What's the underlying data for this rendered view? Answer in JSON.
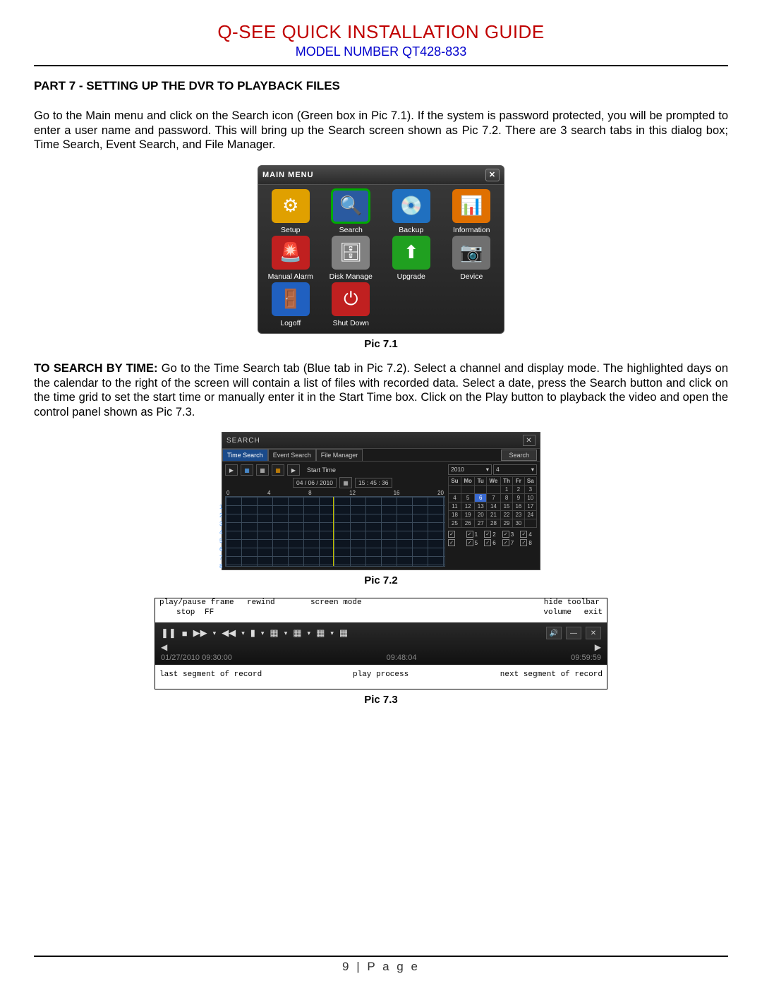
{
  "header": {
    "title": "Q-SEE QUICK INSTALLATION GUIDE",
    "model": "MODEL NUMBER QT428-833"
  },
  "section_heading": "PART 7 - SETTING UP THE DVR TO PLAYBACK FILES",
  "para1": "Go to the Main menu and click on the Search icon (Green box in Pic 7.1). If the system is password protected, you will be prompted to enter a user name and password. This will bring up the Search screen shown as Pic 7.2. There are 3 search tabs in this dialog box; Time Search, Event Search, and File Manager.",
  "para2_lead": "TO SEARCH BY TIME:",
  "para2": " Go to the Time Search tab (Blue tab in Pic 7.2). Select a channel and display mode. The highlighted days on the calendar to the right of the screen will contain a list of files with recorded data. Select a date, press the Search button and click on the time grid to set the start time or manually enter it in the Start Time box. Click on the Play button to playback the video and open the control panel shown as Pic 7.3.",
  "captions": {
    "c1": "Pic 7.1",
    "c2": "Pic 7.2",
    "c3": "Pic 7.3"
  },
  "mainmenu": {
    "title": "MAIN  MENU",
    "close": "✕",
    "items": [
      {
        "label": "Setup",
        "icon": "⚙",
        "bg": "#e0a000"
      },
      {
        "label": "Search",
        "icon": "🔍",
        "bg": "#2a5aa0",
        "highlight": true
      },
      {
        "label": "Backup",
        "icon": "💿",
        "bg": "#2070c0"
      },
      {
        "label": "Information",
        "icon": "📊",
        "bg": "#e07000"
      },
      {
        "label": "Manual Alarm",
        "icon": "🚨",
        "bg": "#c02020"
      },
      {
        "label": "Disk Manage",
        "icon": "🗄",
        "bg": "#808080"
      },
      {
        "label": "Upgrade",
        "icon": "⬆",
        "bg": "#20a020"
      },
      {
        "label": "Device",
        "icon": "📷",
        "bg": "#707070"
      },
      {
        "label": "Logoff",
        "icon": "🚪",
        "bg": "#2060c0"
      },
      {
        "label": "Shut Down",
        "icon": "⏻",
        "bg": "#c02020"
      }
    ]
  },
  "search": {
    "title": "SEARCH",
    "close": "✕",
    "tabs": [
      "Time Search",
      "Event Search",
      "File Manager"
    ],
    "search_btn": "Search",
    "start_time_label": "Start Time",
    "start_date": "04 / 06 / 2010",
    "start_time": "15 : 45 : 36",
    "hours": [
      "0",
      "4",
      "8",
      "12",
      "16",
      "20"
    ],
    "rows": [
      "1",
      "2",
      "3",
      "4",
      "5",
      "6",
      "7",
      "8"
    ],
    "year": "2010",
    "month": "4",
    "dow": [
      "Su",
      "Mo",
      "Tu",
      "We",
      "Th",
      "Fr",
      "Sa"
    ],
    "cal": [
      [
        "",
        "",
        "",
        "",
        "1",
        "2",
        "3"
      ],
      [
        "4",
        "5",
        "6",
        "7",
        "8",
        "9",
        "10"
      ],
      [
        "11",
        "12",
        "13",
        "14",
        "15",
        "16",
        "17"
      ],
      [
        "18",
        "19",
        "20",
        "21",
        "22",
        "23",
        "24"
      ],
      [
        "25",
        "26",
        "27",
        "28",
        "29",
        "30",
        ""
      ]
    ],
    "cal_selected": "6",
    "channels_row1": [
      "1",
      "2",
      "3",
      "4"
    ],
    "channels_row2": [
      "5",
      "6",
      "7",
      "8"
    ]
  },
  "ctrl": {
    "annot_top": {
      "a": "play/pause frame",
      "b": "stop",
      "c": "FF",
      "d": "rewind",
      "e": "screen mode",
      "f": "hide toolbar",
      "g": "volume",
      "h": "exit"
    },
    "times": {
      "start": "01/27/2010  09:30:00",
      "mid": "09:48:04",
      "end": "09:59:59"
    },
    "annot_bot": {
      "a": "last segment of record",
      "b": "play process",
      "c": "next segment of record"
    }
  },
  "page_number": "9 | P a g e"
}
